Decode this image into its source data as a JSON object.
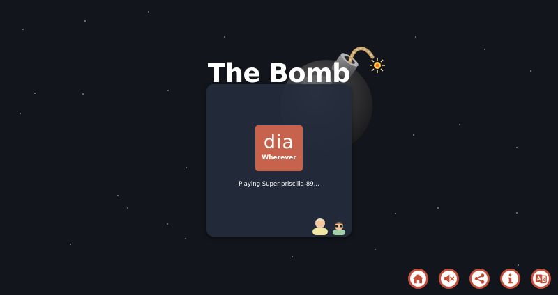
{
  "game": {
    "title": "The Bomb",
    "syllable": "dia",
    "rule": "Wherever",
    "status": "Playing Super-priscilla-89..."
  },
  "players": [
    {
      "avatar": "person-icon"
    },
    {
      "avatar": "person-sunglasses-icon"
    }
  ],
  "toolbar": [
    {
      "icon": "home-icon"
    },
    {
      "icon": "mute-icon"
    },
    {
      "icon": "share-icon"
    },
    {
      "icon": "info-icon"
    },
    {
      "icon": "language-icon"
    }
  ],
  "colors": {
    "background": "#12151c",
    "card": "#242c3c",
    "tile": "#c7634c",
    "button_ring": "#c34f3a"
  }
}
